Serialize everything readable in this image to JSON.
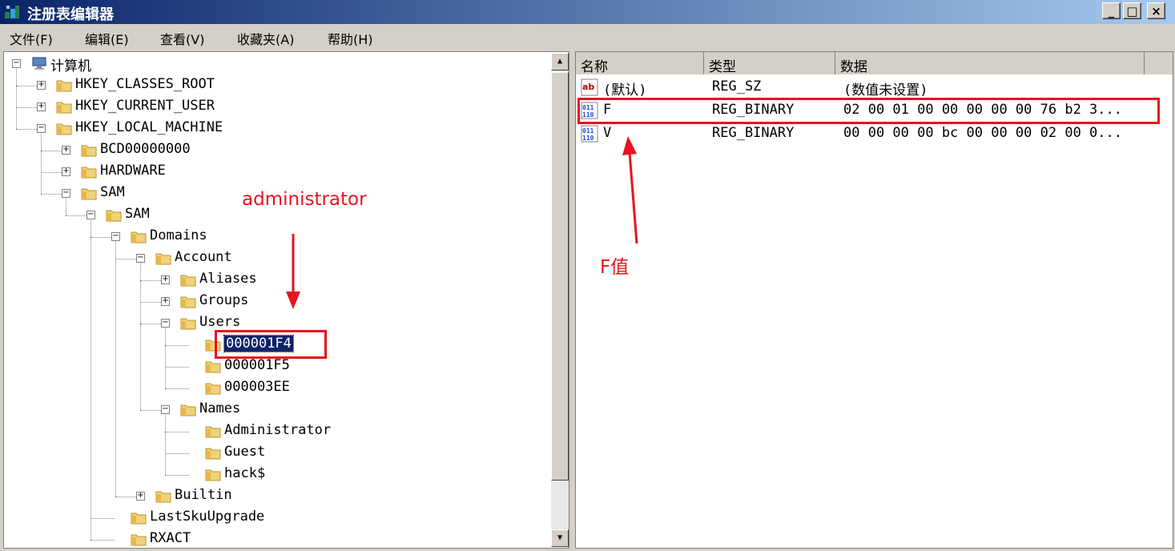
{
  "window": {
    "title": "注册表编辑器",
    "buttons": {
      "minimize": "_",
      "maximize": "□",
      "close": "×"
    }
  },
  "menu": [
    "文件(F)",
    "编辑(E)",
    "查看(V)",
    "收藏夹(A)",
    "帮助(H)"
  ],
  "tree": [
    {
      "label": "计算机",
      "toggle": "−",
      "icon": "computer-icon"
    },
    {
      "label": "HKEY_CLASSES_ROOT",
      "toggle": "+",
      "icon": "folder-icon"
    },
    {
      "label": "HKEY_CURRENT_USER",
      "toggle": "+",
      "icon": "folder-icon"
    },
    {
      "label": "HKEY_LOCAL_MACHINE",
      "toggle": "−",
      "icon": "folder-icon"
    },
    {
      "label": "BCD00000000",
      "toggle": "+",
      "icon": "folder-icon"
    },
    {
      "label": "HARDWARE",
      "toggle": "+",
      "icon": "folder-icon"
    },
    {
      "label": "SAM",
      "toggle": "−",
      "icon": "folder-icon"
    },
    {
      "label": "SAM",
      "toggle": "−",
      "icon": "folder-icon"
    },
    {
      "label": "Domains",
      "toggle": "−",
      "icon": "folder-icon"
    },
    {
      "label": "Account",
      "toggle": "−",
      "icon": "folder-icon"
    },
    {
      "label": "Aliases",
      "toggle": "+",
      "icon": "folder-icon"
    },
    {
      "label": "Groups",
      "toggle": "+",
      "icon": "folder-icon"
    },
    {
      "label": "Users",
      "toggle": "−",
      "icon": "folder-icon"
    },
    {
      "label": "000001F4",
      "toggle": "",
      "icon": "folder-icon",
      "selected": true
    },
    {
      "label": "000001F5",
      "toggle": "",
      "icon": "folder-icon"
    },
    {
      "label": "000003EE",
      "toggle": "",
      "icon": "folder-icon"
    },
    {
      "label": "Names",
      "toggle": "−",
      "icon": "folder-icon"
    },
    {
      "label": "Administrator",
      "toggle": "",
      "icon": "folder-icon"
    },
    {
      "label": "Guest",
      "toggle": "",
      "icon": "folder-icon"
    },
    {
      "label": "hack$",
      "toggle": "",
      "icon": "folder-icon"
    },
    {
      "label": "Builtin",
      "toggle": "+",
      "icon": "folder-icon"
    },
    {
      "label": "LastSkuUpgrade",
      "toggle": "",
      "icon": "folder-icon"
    },
    {
      "label": "RXACT",
      "toggle": "",
      "icon": "folder-icon"
    }
  ],
  "list": {
    "columns": [
      "名称",
      "类型",
      "数据"
    ],
    "rows": [
      {
        "name": "(默认)",
        "type": "REG_SZ",
        "data": "(数值未设置)",
        "icon": "string-value-icon"
      },
      {
        "name": "F",
        "type": "REG_BINARY",
        "data": "02 00 01 00 00 00 00 00 76 b2 3...",
        "icon": "binary-value-icon"
      },
      {
        "name": "V",
        "type": "REG_BINARY",
        "data": "00 00 00 00 bc 00 00 00 02 00 0...",
        "icon": "binary-value-icon"
      }
    ]
  },
  "annotations": {
    "administrator": "administrator",
    "f_value": "F值",
    "color": "#e8131c"
  },
  "colors": {
    "titlebar_start": "#0a246a",
    "selection": "#0a246a",
    "face": "#d4d0c8"
  }
}
